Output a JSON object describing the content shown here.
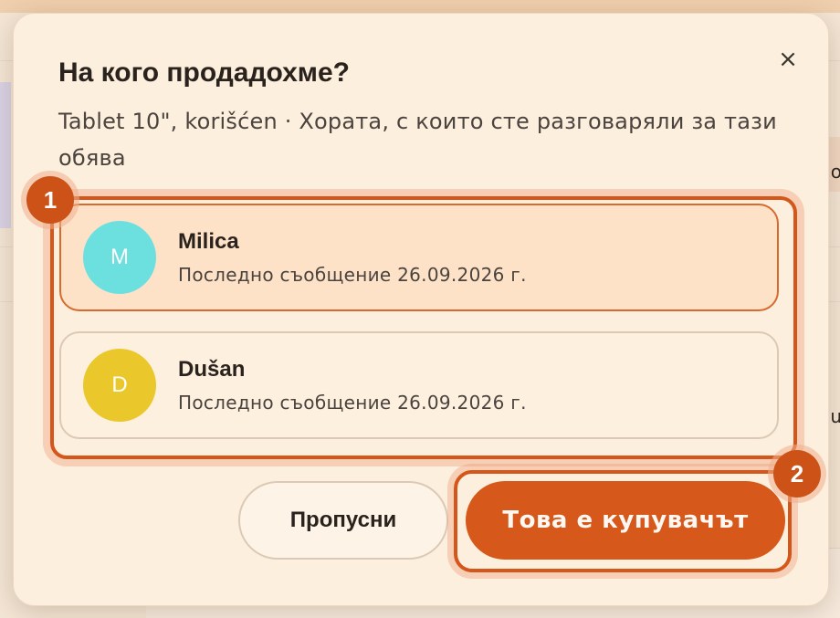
{
  "dialog": {
    "title": "На кого продадохме?",
    "subtitle": "Tablet 10\", korišćen · Хората, с които сте разговаряли за тази обява",
    "close_icon": "×"
  },
  "buyers": [
    {
      "initial": "M",
      "name": "Milica",
      "last_message": "Последно съобщение 26.09.2026 г.",
      "avatar_color": "#6be0df",
      "selected": true
    },
    {
      "initial": "D",
      "name": "Dušan",
      "last_message": "Последно съобщение 26.09.2026 г.",
      "avatar_color": "#eac72a",
      "selected": false
    }
  ],
  "actions": {
    "skip_label": "Пропусни",
    "confirm_label": "Това е купувачът"
  },
  "badges": {
    "list": "1",
    "confirm": "2"
  },
  "background": {
    "fragment_right_1": "o",
    "fragment_right_2": "u"
  },
  "colors": {
    "accent": "#d6581b",
    "dialog_bg": "#fdefdd"
  }
}
